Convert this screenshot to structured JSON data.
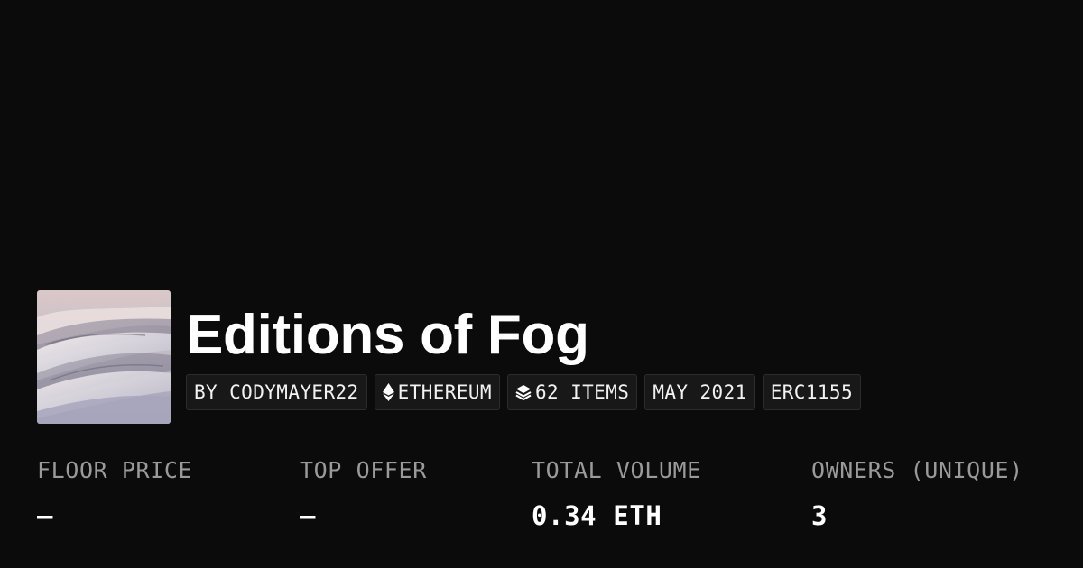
{
  "collection": {
    "title": "Editions of Fog",
    "thumbnail_icon": "fog-landscape-thumbnail"
  },
  "chips": [
    {
      "label": "BY CODYMAYER22",
      "icon": null
    },
    {
      "label": "ETHEREUM",
      "icon": "ethereum-icon"
    },
    {
      "label": "62 ITEMS",
      "icon": "layers-icon"
    },
    {
      "label": "MAY 2021",
      "icon": null
    },
    {
      "label": "ERC1155",
      "icon": null
    }
  ],
  "stats": [
    {
      "label": "FLOOR PRICE",
      "value": "—"
    },
    {
      "label": "TOP OFFER",
      "value": "—"
    },
    {
      "label": "TOTAL VOLUME",
      "value": "0.34 ETH"
    },
    {
      "label": "OWNERS (UNIQUE)",
      "value": "3"
    }
  ],
  "colors": {
    "background": "#0b0b0b",
    "text": "#ffffff",
    "muted": "#9a9a9a",
    "chip_bg": "#181818",
    "chip_border": "#2c2c2c"
  }
}
